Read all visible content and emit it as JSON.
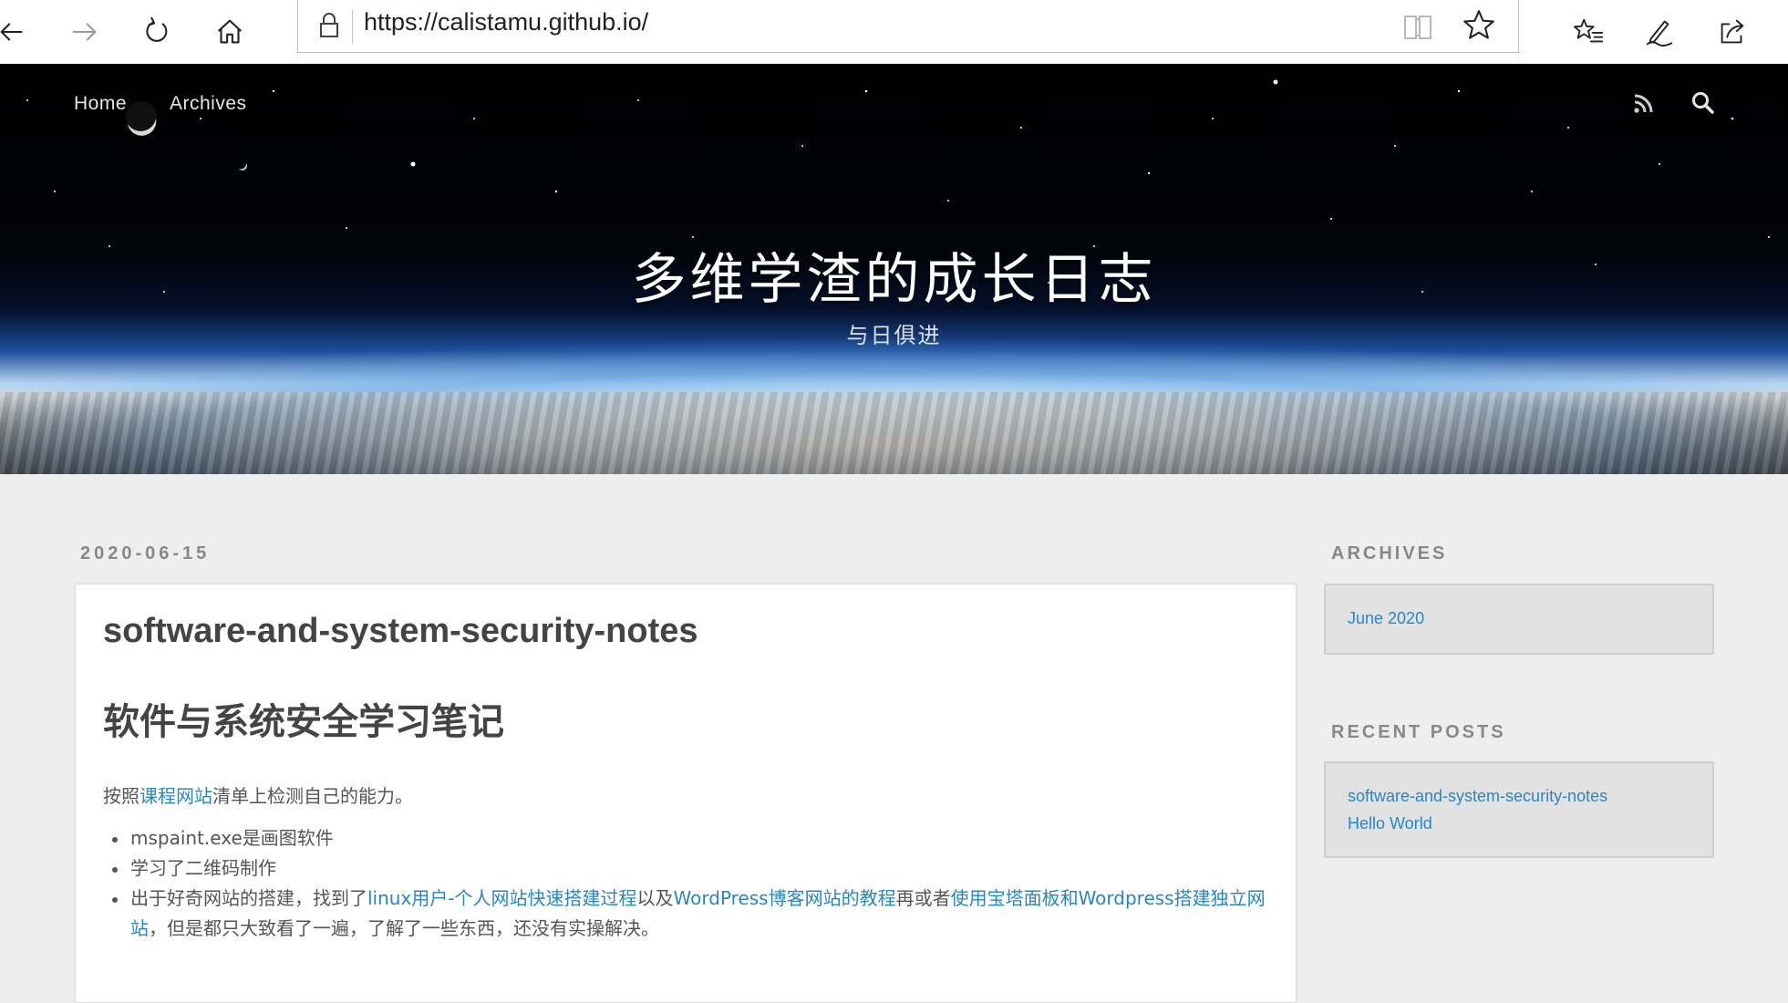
{
  "browser": {
    "url": "https://calistamu.github.io/",
    "icons": {
      "back": "arrow-left-icon",
      "forward": "arrow-right-icon",
      "refresh": "refresh-icon",
      "home": "home-icon",
      "lock": "lock-icon",
      "reading_view": "book-icon",
      "favorite": "star-icon",
      "favorites_list": "favorites-list-icon",
      "notes": "pen-icon",
      "share": "share-icon"
    }
  },
  "header": {
    "nav": [
      "Home",
      "Archives"
    ],
    "site_title": "多维学渣的成长日志",
    "site_subtitle": "与日俱进",
    "icons": {
      "rss": "rss-icon",
      "search": "search-icon"
    }
  },
  "post": {
    "date": "2020-06-15",
    "title": "software-and-system-security-notes",
    "heading": "软件与系统安全学习笔记",
    "intro": {
      "before": "按照",
      "link": "课程网站",
      "after": "清单上检测自己的能力。"
    },
    "list": {
      "item1": "mspaint.exe是画图软件",
      "item2": "学习了二维码制作",
      "item3": {
        "text1": "出于好奇网站的搭建，找到了",
        "link1": "linux用户-个人网站快速搭建过程",
        "text2": "以及",
        "link2": "WordPress博客网站的教程",
        "text3": "再或者",
        "link3": "使用宝塔面板和Wordpress搭建独立网站",
        "text4": "，但是都只大致看了一遍，了解了一些东西，还没有实操解决。"
      }
    }
  },
  "sidebar": {
    "archives_title": "ARCHIVES",
    "archives": [
      "June 2020"
    ],
    "recent_title": "RECENT POSTS",
    "recent_posts": [
      "software-and-system-security-notes",
      "Hello World"
    ]
  },
  "colors": {
    "link": "#2786c4",
    "text": "#555555",
    "heading": "#444444",
    "page_bg": "#eeeeee",
    "widget_bg": "#e2e2e2"
  }
}
